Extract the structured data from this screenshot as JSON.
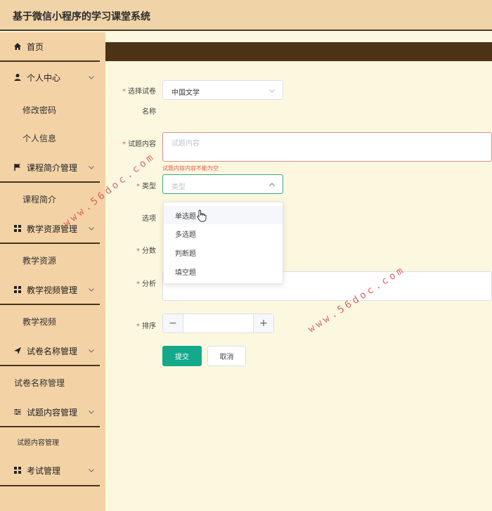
{
  "app": {
    "title": "基于微信小程序的学习课堂系统"
  },
  "sidebar": {
    "home": "首页",
    "personal_center": "个人中心",
    "change_password": "修改密码",
    "personal_info": "个人信息",
    "course_intro_mgmt": "课程简介管理",
    "course_intro": "课程简介",
    "teaching_resource_mgmt": "教学资源管理",
    "teaching_resource": "教学资源",
    "teaching_video_mgmt": "教学视频管理",
    "teaching_video": "教学视频",
    "paper_name_mgmt": "试卷名称管理",
    "paper_name_mgmt_sub": "试卷名称管理",
    "question_content_mgmt": "试题内容管理",
    "question_content_mgmt_sub": "试题内容管理",
    "exam_mgmt": "考试管理"
  },
  "form": {
    "paper_label_line1": "选择试卷",
    "paper_label_line2": "名称",
    "paper_value": "中国文学",
    "content_label": "试题内容",
    "content_placeholder": "试题内容",
    "content_error": "试题内容内容不能为空",
    "type_label": "类型",
    "type_placeholder": "类型",
    "type_options": [
      "单选题",
      "多选题",
      "判断题",
      "填空题"
    ],
    "options_label": "选项",
    "score_label": "分数",
    "analysis_label": "分析",
    "sort_label": "排序",
    "submit": "提交",
    "cancel": "取消"
  },
  "watermarks": {
    "mark1": "www.56doc.com",
    "mark2": "www.56doc.com"
  },
  "colors": {
    "accent": "#13a98a",
    "error": "#e05a50",
    "sidebar": "#f3d3a6",
    "topbar": "#4d3315"
  }
}
